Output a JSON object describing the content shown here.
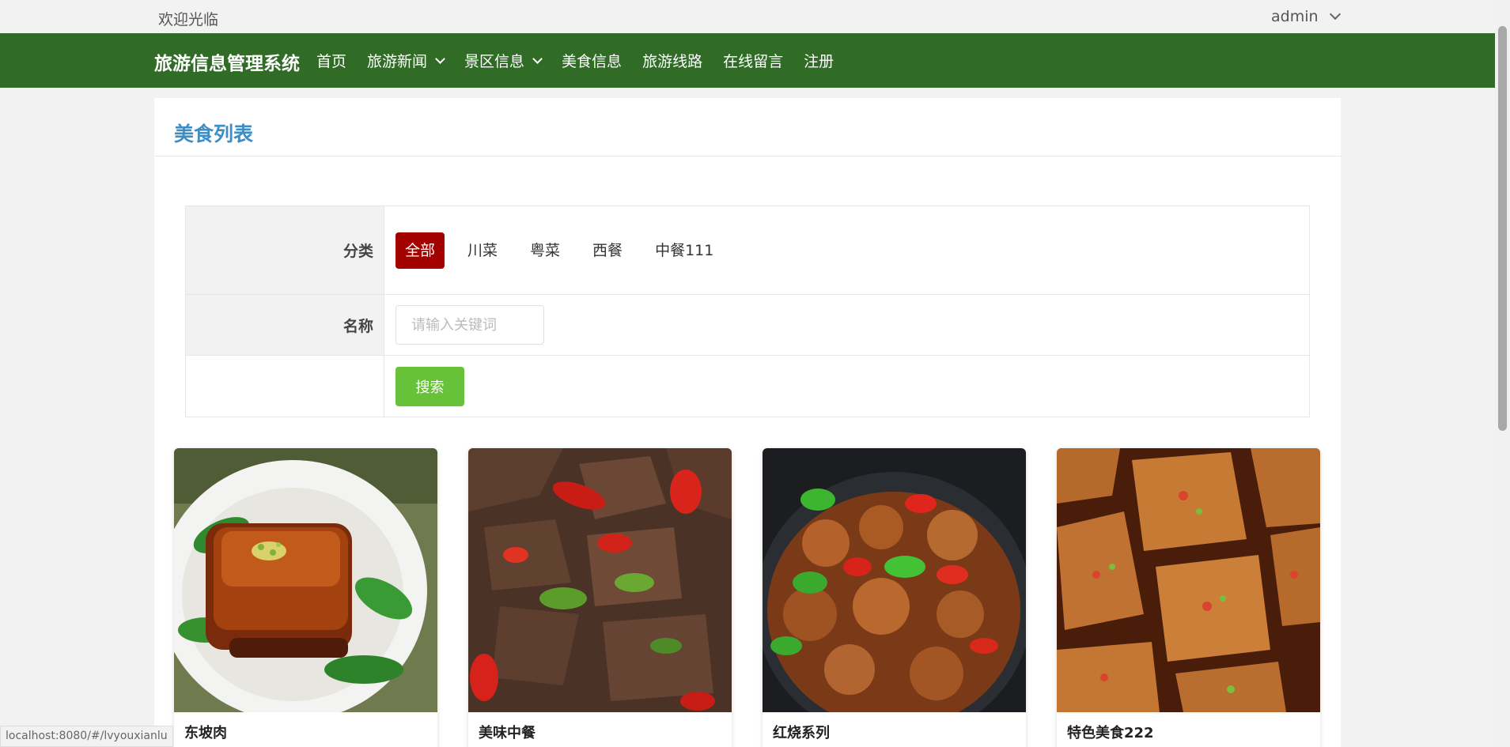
{
  "topbar": {
    "welcome": "欢迎光临",
    "user": "admin"
  },
  "navbar": {
    "brand": "旅游信息管理系统",
    "items": [
      {
        "label": "首页",
        "dropdown": false
      },
      {
        "label": "旅游新闻",
        "dropdown": true
      },
      {
        "label": "景区信息",
        "dropdown": true
      },
      {
        "label": "美食信息",
        "dropdown": false
      },
      {
        "label": "旅游线路",
        "dropdown": false
      },
      {
        "label": "在线留言",
        "dropdown": false
      },
      {
        "label": "注册",
        "dropdown": false
      }
    ],
    "bg_color": "#316c27"
  },
  "panel": {
    "title": "美食列表"
  },
  "filter": {
    "category_label": "分类",
    "categories": [
      "全部",
      "川菜",
      "粤菜",
      "西餐",
      "中餐111"
    ],
    "active_category": "全部",
    "name_label": "名称",
    "name_placeholder": "请输入关键词",
    "name_value": "",
    "search_label": "搜索"
  },
  "foods": [
    {
      "name": "东坡肉",
      "image": "braised-pork-photo"
    },
    {
      "name": "美味中餐",
      "image": "stir-fried-liver-photo"
    },
    {
      "name": "红烧系列",
      "image": "braised-intestine-photo"
    },
    {
      "name": "特色美食222",
      "image": "fried-tofu-photo"
    }
  ],
  "status_url": "localhost:8080/#/lvyouxianlu",
  "colors": {
    "accent_title": "#3d8ec4",
    "active_category": "#a30000",
    "search_button": "#67c23a"
  }
}
